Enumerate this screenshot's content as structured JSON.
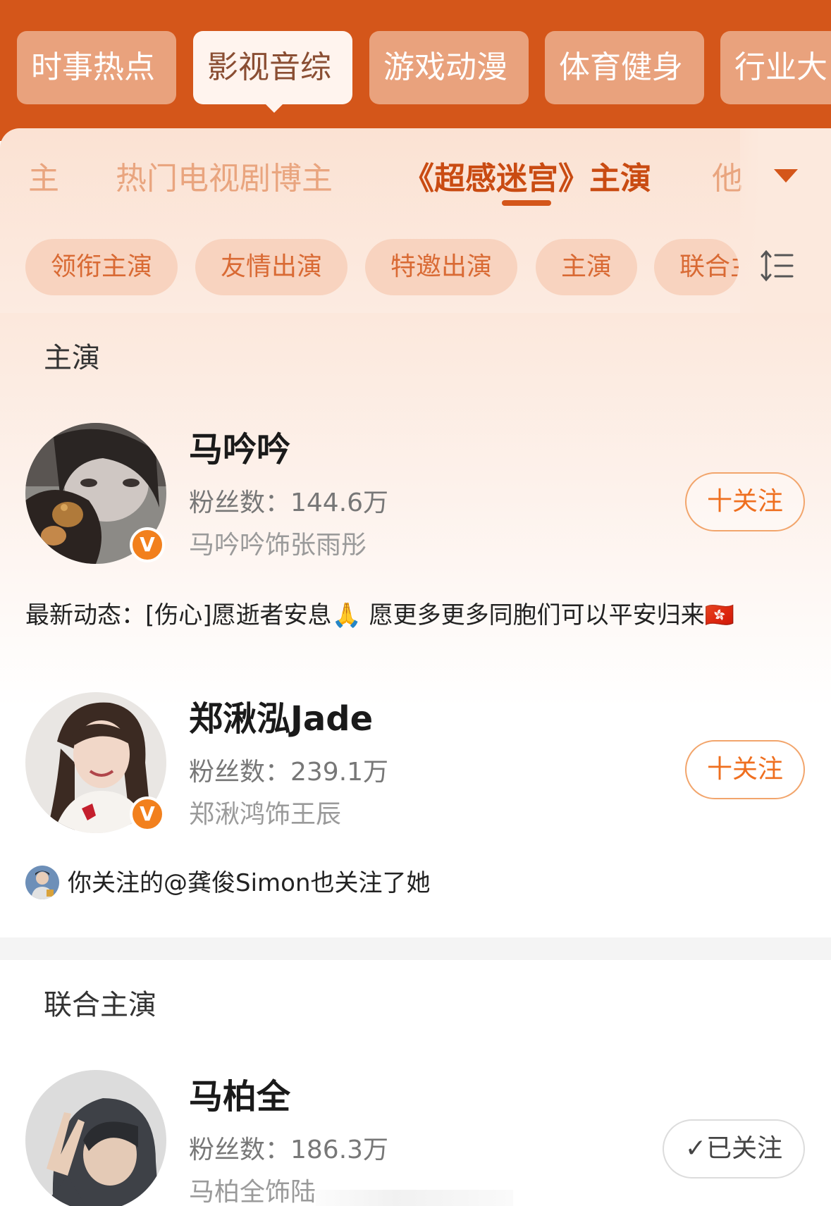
{
  "categories": [
    {
      "label": "时事热点",
      "active": false
    },
    {
      "label": "影视音综",
      "active": true
    },
    {
      "label": "游戏动漫",
      "active": false
    },
    {
      "label": "体育健身",
      "active": false
    },
    {
      "label": "行业大",
      "active": false
    }
  ],
  "subtabs": [
    {
      "label": "主",
      "active": false
    },
    {
      "label": "热门电视剧博主",
      "active": false
    },
    {
      "label": "《超感迷宫》主演",
      "active": true
    },
    {
      "label": "他",
      "active": false
    }
  ],
  "chips": [
    "领衔主演",
    "友情出演",
    "特邀出演",
    "主演",
    "联合主"
  ],
  "sections": [
    {
      "title": "主演",
      "people": [
        {
          "name": "马吟吟",
          "fans": "粉丝数：144.6万",
          "role": "马吟吟饰张雨彤",
          "button": "十关注",
          "activity": "最新动态：[伤心]愿逝者安息🙏 愿更多更多同胞们可以平安归来🇭🇰"
        },
        {
          "name": "郑湫泓Jade",
          "fans": "粉丝数：239.1万",
          "role": "郑湫鸿饰王辰",
          "button": "十关注",
          "mutual": "你关注的@龚俊Simon也关注了她"
        }
      ]
    },
    {
      "title": "联合主演",
      "people": [
        {
          "name": "马柏全",
          "fans": "粉丝数：186.3万",
          "role": "马柏全饰陆",
          "button": "✓已关注"
        }
      ]
    }
  ],
  "badge_letter": "V",
  "colors": {
    "brand_orange": "#d4561a",
    "follow_orange": "#ef6f1f",
    "badge_orange": "#f2801d"
  }
}
